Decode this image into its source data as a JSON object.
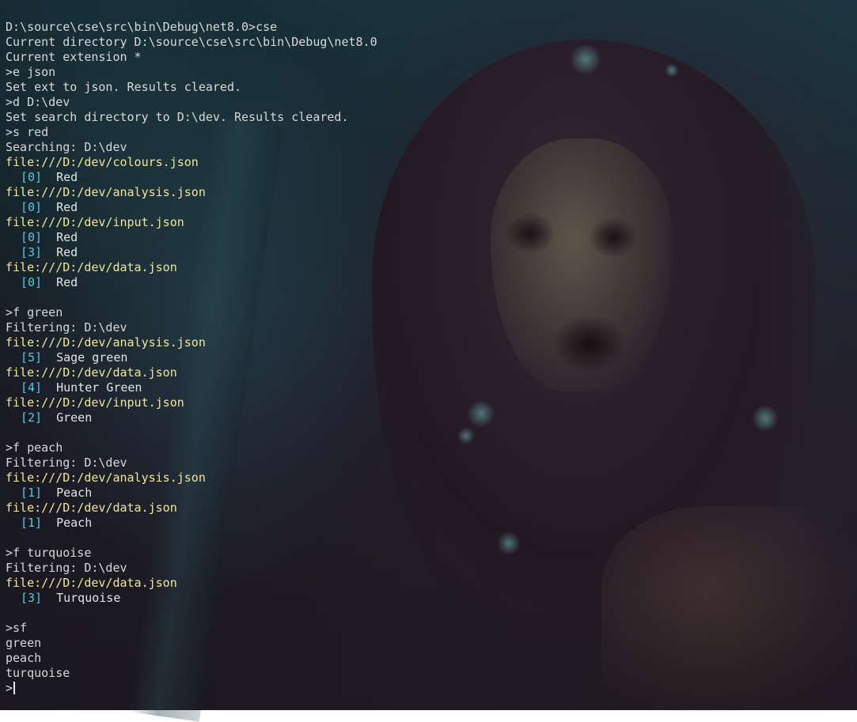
{
  "terminal": {
    "lines": [
      {
        "type": "text",
        "text": "D:\\source\\cse\\src\\bin\\Debug\\net8.0>cse"
      },
      {
        "type": "text",
        "text": "Current directory D:\\source\\cse\\src\\bin\\Debug\\net8.0"
      },
      {
        "type": "text",
        "text": "Current extension *"
      },
      {
        "type": "text",
        "text": ">e json"
      },
      {
        "type": "text",
        "text": "Set ext to json. Results cleared."
      },
      {
        "type": "text",
        "text": ">d D:\\dev"
      },
      {
        "type": "text",
        "text": "Set search directory to D:\\dev. Results cleared."
      },
      {
        "type": "text",
        "text": ">s red"
      },
      {
        "type": "text",
        "text": "Searching: D:\\dev"
      },
      {
        "type": "link",
        "text": "file:///D:/dev/colours.json"
      },
      {
        "type": "result",
        "index": "[0]",
        "value": "Red"
      },
      {
        "type": "link",
        "text": "file:///D:/dev/analysis.json"
      },
      {
        "type": "result",
        "index": "[0]",
        "value": "Red"
      },
      {
        "type": "link",
        "text": "file:///D:/dev/input.json"
      },
      {
        "type": "result",
        "index": "[0]",
        "value": "Red"
      },
      {
        "type": "result",
        "index": "[3]",
        "value": "Red"
      },
      {
        "type": "link",
        "text": "file:///D:/dev/data.json"
      },
      {
        "type": "result",
        "index": "[0]",
        "value": "Red"
      },
      {
        "type": "blank"
      },
      {
        "type": "text",
        "text": ">f green"
      },
      {
        "type": "text",
        "text": "Filtering: D:\\dev"
      },
      {
        "type": "link",
        "text": "file:///D:/dev/analysis.json"
      },
      {
        "type": "result",
        "index": "[5]",
        "value": "Sage green"
      },
      {
        "type": "link",
        "text": "file:///D:/dev/data.json"
      },
      {
        "type": "result",
        "index": "[4]",
        "value": "Hunter Green"
      },
      {
        "type": "link",
        "text": "file:///D:/dev/input.json"
      },
      {
        "type": "result",
        "index": "[2]",
        "value": "Green"
      },
      {
        "type": "blank"
      },
      {
        "type": "text",
        "text": ">f peach"
      },
      {
        "type": "text",
        "text": "Filtering: D:\\dev"
      },
      {
        "type": "link",
        "text": "file:///D:/dev/analysis.json"
      },
      {
        "type": "result",
        "index": "[1]",
        "value": "Peach"
      },
      {
        "type": "link",
        "text": "file:///D:/dev/data.json"
      },
      {
        "type": "result",
        "index": "[1]",
        "value": "Peach"
      },
      {
        "type": "blank"
      },
      {
        "type": "text",
        "text": ">f turquoise"
      },
      {
        "type": "text",
        "text": "Filtering: D:\\dev"
      },
      {
        "type": "link",
        "text": "file:///D:/dev/data.json"
      },
      {
        "type": "result",
        "index": "[3]",
        "value": "Turquoise"
      },
      {
        "type": "blank"
      },
      {
        "type": "text",
        "text": ">sf"
      },
      {
        "type": "text",
        "text": "green"
      },
      {
        "type": "text",
        "text": "peach"
      },
      {
        "type": "text",
        "text": "turquoise"
      },
      {
        "type": "prompt",
        "text": ">"
      }
    ]
  },
  "colors": {
    "text": "#d8d8d8",
    "link": "#f0e69a",
    "index": "#58c6e0"
  }
}
